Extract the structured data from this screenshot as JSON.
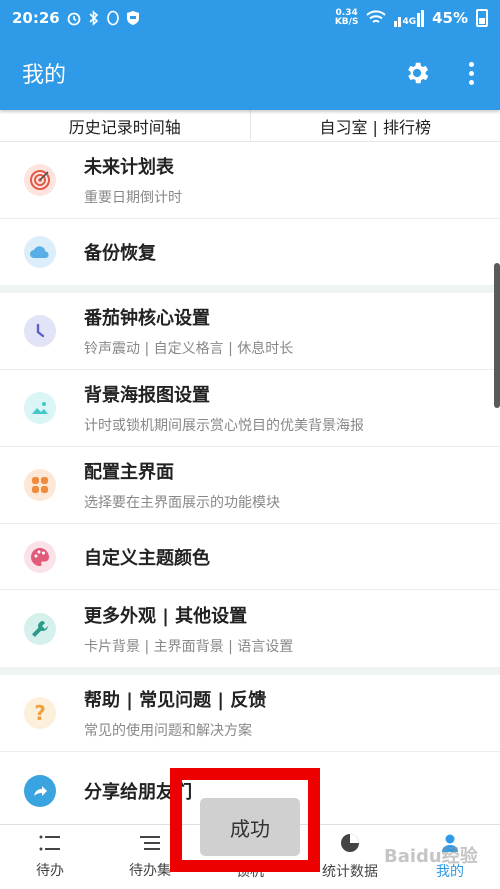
{
  "status_bar": {
    "time": "20:26",
    "speed_value": "0.34",
    "speed_unit": "KB/S",
    "network": "4G",
    "battery": "45%"
  },
  "app_bar": {
    "title": "我的",
    "settings_icon": "gear-icon",
    "more_icon": "more-vert-icon"
  },
  "top_row": {
    "left": "历史记录时间轴",
    "right": "自习室 | 排行榜"
  },
  "sections": [
    {
      "items": [
        {
          "title": "未来计划表",
          "subtitle": "重要日期倒计时",
          "icon": "target-icon",
          "color": "#e05a47",
          "bg": "#fde4df"
        },
        {
          "title": "备份恢复",
          "subtitle": "",
          "icon": "cloud-icon",
          "color": "#5aaee8",
          "bg": "#ddeefb"
        }
      ]
    },
    {
      "items": [
        {
          "title": "番茄钟核心设置",
          "subtitle": "铃声震动 | 自定义格言 | 休息时长",
          "icon": "clock-icon",
          "color": "#5b5fc7",
          "bg": "#e3e3f7"
        },
        {
          "title": "背景海报图设置",
          "subtitle": "计时或锁机期间展示赏心悦目的优美背景海报",
          "icon": "image-icon",
          "color": "#45c8c8",
          "bg": "#d9f5f5"
        },
        {
          "title": "配置主界面",
          "subtitle": "选择要在主界面展示的功能模块",
          "icon": "grid-icon",
          "color": "#f08a3c",
          "bg": "#fde7d6"
        },
        {
          "title": "自定义主题颜色",
          "subtitle": "",
          "icon": "palette-icon",
          "color": "#e05a7a",
          "bg": "#fbe2e8"
        },
        {
          "title": "更多外观 | 其他设置",
          "subtitle": "卡片背景 | 主界面背景 | 语言设置",
          "icon": "wrench-icon",
          "color": "#2a9a8a",
          "bg": "#d6f0ec"
        }
      ]
    },
    {
      "items": [
        {
          "title": "帮助 | 常见问题 | 反馈",
          "subtitle": "常见的使用问题和解决方案",
          "icon": "help-icon",
          "color": "#f0a03c",
          "bg": "#fdf0da"
        },
        {
          "title": "分享给朋友们",
          "subtitle": "",
          "icon": "share-icon",
          "color": "#3aa4e0",
          "bg": "#ffffff"
        }
      ]
    }
  ],
  "bottom_nav": [
    {
      "label": "待办",
      "icon": "list-icon",
      "active": false
    },
    {
      "label": "待办集",
      "icon": "list-icon",
      "active": false
    },
    {
      "label": "锁机",
      "icon": "lock-icon",
      "active": false
    },
    {
      "label": "统计数据",
      "icon": "pie-icon",
      "active": false
    },
    {
      "label": "我的",
      "icon": "person-icon",
      "active": true
    }
  ],
  "toast": {
    "text": "成功"
  },
  "watermark": {
    "text": "Baidu经验"
  },
  "colors": {
    "primary": "#2e9ae8",
    "highlight_frame": "#ee0000"
  }
}
